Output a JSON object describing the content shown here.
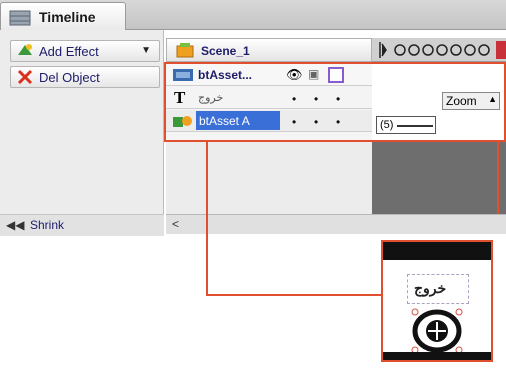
{
  "window": {
    "tab_title": "Timeline",
    "tab_icon": "timeline-icon"
  },
  "left_panel": {
    "add_effect": "Add Effect",
    "del_object": "Del Object",
    "shrink": "Shrink",
    "shrink_icon": "rewind-icon"
  },
  "scene": {
    "label": "Scene_1",
    "icon": "scene-icon"
  },
  "layers": [
    {
      "name": "btAsset...",
      "icon": "button-layer-icon"
    },
    {
      "name": "خروج",
      "icon": "text-layer-icon"
    },
    {
      "name": "btAsset A",
      "icon": "shape-layer-icon"
    }
  ],
  "timeline": {
    "zoom_label": "Zoom",
    "frame_value": "(5)"
  },
  "scroll": {
    "left_arrow": "<"
  },
  "preview": {
    "label": "خروج"
  },
  "colors": {
    "accent": "#e0502e",
    "selection": "#3b6fd8"
  }
}
